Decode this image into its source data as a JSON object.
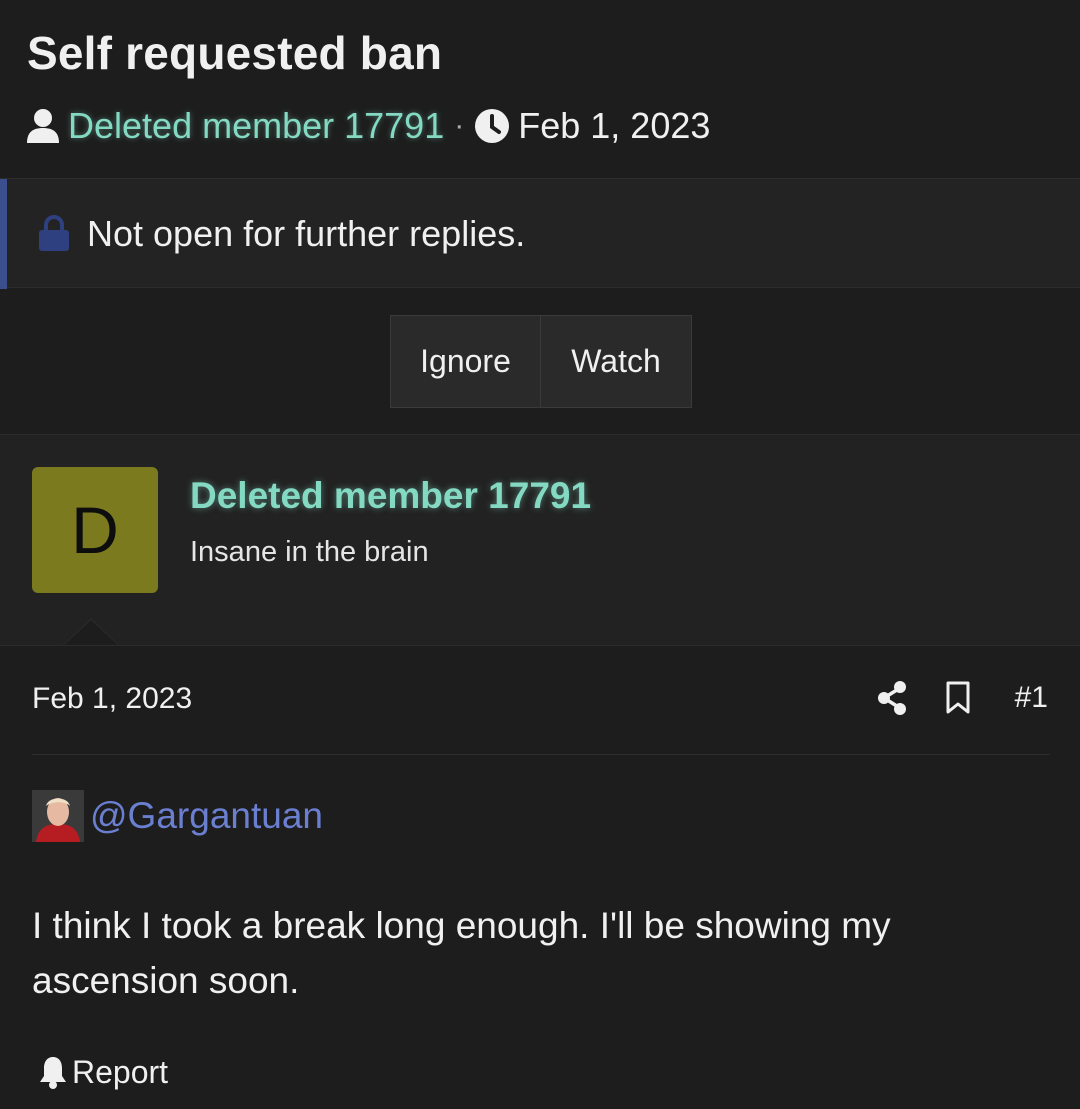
{
  "thread": {
    "title": "Self requested ban",
    "author": "Deleted member 17791",
    "separator": "·",
    "date": "Feb 1, 2023"
  },
  "notice": {
    "text": "Not open for further replies.",
    "icon": "lock-icon",
    "accent_color": "#3b4f8f"
  },
  "actions": {
    "ignore_label": "Ignore",
    "watch_label": "Watch"
  },
  "user": {
    "avatar_letter": "D",
    "avatar_color": "#7b7a1f",
    "name": "Deleted member 17791",
    "name_color": "#84d9c2",
    "title": "Insane in the brain"
  },
  "post": {
    "date": "Feb 1, 2023",
    "number": "#1",
    "share_icon": "share-icon",
    "bookmark_icon": "bookmark-icon",
    "mention": "@Gargantuan",
    "mention_color": "#6b7fd1",
    "body": "I think I took a break long enough. I'll be showing my ascension soon.",
    "report_label": "Report",
    "report_icon": "bell-icon"
  }
}
